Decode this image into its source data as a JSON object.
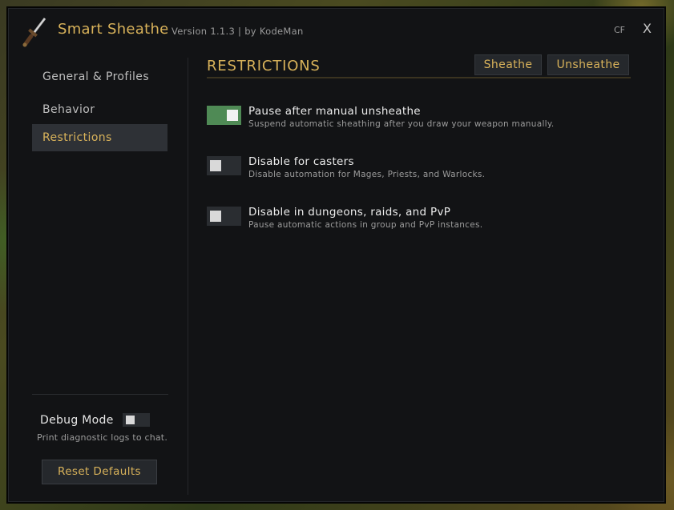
{
  "app": {
    "title": "Smart Sheathe",
    "meta": "Version 1.1.3  |  by KodeMan",
    "cf_label": "CF",
    "close_label": "X",
    "icon": "dagger-icon"
  },
  "sidebar": {
    "items": [
      {
        "label": "General & Profiles",
        "active": false
      },
      {
        "label": "Behavior",
        "active": false
      },
      {
        "label": "Restrictions",
        "active": true
      }
    ],
    "debug": {
      "label": "Debug Mode",
      "description": "Print diagnostic logs to chat.",
      "enabled": false
    },
    "reset_label": "Reset Defaults"
  },
  "main": {
    "title": "RESTRICTIONS",
    "sheathe_label": "Sheathe",
    "unsheathe_label": "Unsheathe",
    "options": [
      {
        "label": "Pause after manual unsheathe",
        "description": "Suspend automatic sheathing after you draw your weapon manually.",
        "enabled": true
      },
      {
        "label": "Disable for casters",
        "description": "Disable automation for Mages, Priests, and Warlocks.",
        "enabled": false
      },
      {
        "label": "Disable in dungeons, raids, and PvP",
        "description": "Pause automatic actions in group and PvP instances.",
        "enabled": false
      }
    ]
  },
  "colors": {
    "accent": "#d8b25a",
    "toggle_on": "#4f8a55",
    "panel_bg": "#121315",
    "active_nav_bg": "#2e3136"
  }
}
